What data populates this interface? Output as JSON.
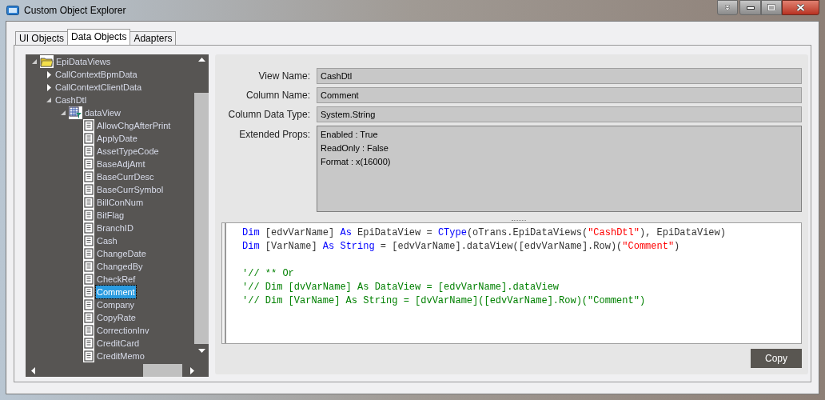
{
  "window": {
    "title": "Custom Object Explorer"
  },
  "tabs": [
    {
      "label": "UI Objects",
      "selected": false
    },
    {
      "label": "Data Objects",
      "selected": true
    },
    {
      "label": "Adapters",
      "selected": false
    }
  ],
  "tree": [
    {
      "kind": "folder",
      "label": "EpiDataViews",
      "expanded": true,
      "selected": false,
      "children": [
        {
          "label": "CallContextBpmData",
          "expanded": false,
          "selected": false
        },
        {
          "label": "CallContextClientData",
          "expanded": false,
          "selected": false
        },
        {
          "label": "CashDtl",
          "expanded": true,
          "selected": false,
          "children": [
            {
              "kind": "view",
              "label": "dataView",
              "expanded": true,
              "selected": false,
              "children": [
                {
                  "kind": "column",
                  "label": "AllowChgAfterPrint",
                  "selected": false
                },
                {
                  "kind": "column",
                  "label": "ApplyDate",
                  "selected": false
                },
                {
                  "kind": "column",
                  "label": "AssetTypeCode",
                  "selected": false
                },
                {
                  "kind": "column",
                  "label": "BaseAdjAmt",
                  "selected": false
                },
                {
                  "kind": "column",
                  "label": "BaseCurrDesc",
                  "selected": false
                },
                {
                  "kind": "column",
                  "label": "BaseCurrSymbol",
                  "selected": false
                },
                {
                  "kind": "column",
                  "label": "BillConNum",
                  "selected": false
                },
                {
                  "kind": "column",
                  "label": "BitFlag",
                  "selected": false
                },
                {
                  "kind": "column",
                  "label": "BranchID",
                  "selected": false
                },
                {
                  "kind": "column",
                  "label": "Cash",
                  "selected": false
                },
                {
                  "kind": "column",
                  "label": "ChangeDate",
                  "selected": false
                },
                {
                  "kind": "column",
                  "label": "ChangedBy",
                  "selected": false
                },
                {
                  "kind": "column",
                  "label": "CheckRef",
                  "selected": false
                },
                {
                  "kind": "column",
                  "label": "Comment",
                  "selected": true
                },
                {
                  "kind": "column",
                  "label": "Company",
                  "selected": false
                },
                {
                  "kind": "column",
                  "label": "CopyRate",
                  "selected": false
                },
                {
                  "kind": "column",
                  "label": "CorrectionInv",
                  "selected": false
                },
                {
                  "kind": "column",
                  "label": "CreditCard",
                  "selected": false
                },
                {
                  "kind": "column",
                  "label": "CreditMemo",
                  "selected": false
                }
              ]
            }
          ]
        }
      ]
    }
  ],
  "details": {
    "fields": [
      {
        "label": "View Name:",
        "value": "CashDtl"
      },
      {
        "label": "Column Name:",
        "value": "Comment"
      },
      {
        "label": "Column Data Type:",
        "value": "System.String"
      }
    ],
    "extended_props": {
      "label": "Extended Props:",
      "lines": [
        "Enabled : True",
        "ReadOnly : False",
        "Format : x(16000)"
      ]
    }
  },
  "code": {
    "blocks": [
      [
        [
          {
            "kind": "keyword",
            "text": "Dim"
          },
          {
            "kind": "plain",
            "text": " [edvVarName] "
          },
          {
            "kind": "keyword",
            "text": "As"
          },
          {
            "kind": "plain",
            "text": " EpiDataView = "
          },
          {
            "kind": "keyword",
            "text": "CType"
          },
          {
            "kind": "plain",
            "text": "(oTrans.EpiDataViews("
          },
          {
            "kind": "string",
            "text": "\"CashDtl\""
          },
          {
            "kind": "plain",
            "text": "), EpiDataView)"
          }
        ],
        [
          {
            "kind": "keyword",
            "text": "Dim"
          },
          {
            "kind": "plain",
            "text": " [VarName] "
          },
          {
            "kind": "keyword",
            "text": "As String"
          },
          {
            "kind": "plain",
            "text": " = [edvVarName].dataView([edvVarName].Row)("
          },
          {
            "kind": "string",
            "text": "\"Comment\""
          },
          {
            "kind": "plain",
            "text": ")"
          }
        ]
      ],
      [
        [
          {
            "kind": "comment",
            "text": "'// ** Or"
          }
        ],
        [
          {
            "kind": "comment",
            "text": "'// Dim [dvVarName] As DataView = [edvVarName].dataView"
          }
        ],
        [
          {
            "kind": "comment",
            "text": "'// Dim [VarName] As String = [dvVarName]([edvVarName].Row)(\"Comment\")"
          }
        ]
      ]
    ]
  },
  "copy_button": "Copy"
}
